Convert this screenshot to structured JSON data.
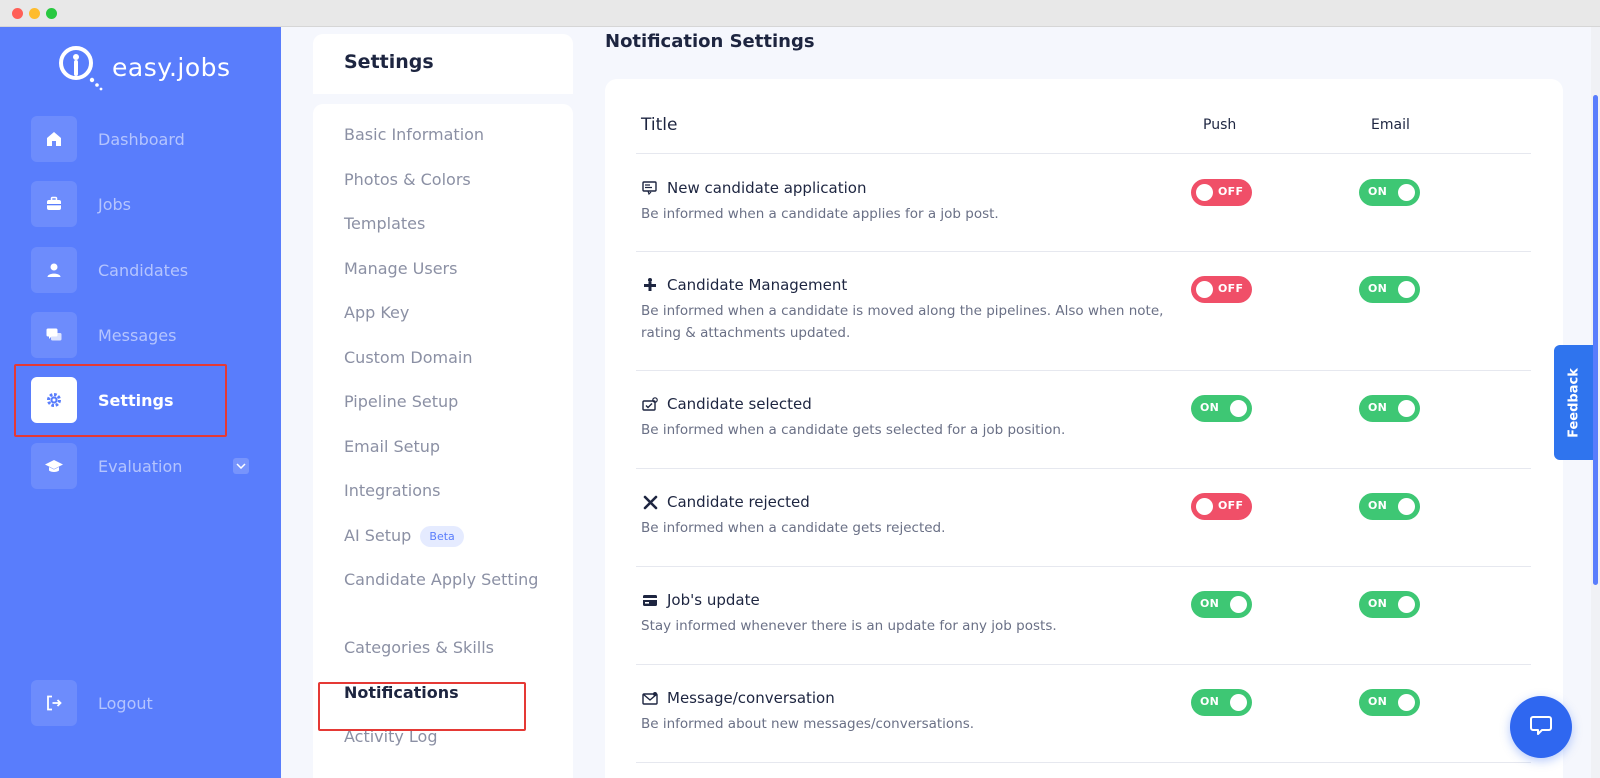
{
  "app": {
    "name": "easy.jobs"
  },
  "sidebar": {
    "items": [
      {
        "label": "Dashboard",
        "icon": "home-icon"
      },
      {
        "label": "Jobs",
        "icon": "briefcase-icon"
      },
      {
        "label": "Candidates",
        "icon": "user-icon"
      },
      {
        "label": "Messages",
        "icon": "chat-icon"
      },
      {
        "label": "Settings",
        "icon": "gear-icon",
        "active": true
      },
      {
        "label": "Evaluation",
        "icon": "graduation-cap-icon",
        "has_dropdown": true
      }
    ],
    "logout": {
      "label": "Logout",
      "icon": "logout-icon"
    }
  },
  "settings_menu": {
    "title": "Settings",
    "items": [
      {
        "label": "Basic Information"
      },
      {
        "label": "Photos & Colors"
      },
      {
        "label": "Templates"
      },
      {
        "label": "Manage Users"
      },
      {
        "label": "App Key"
      },
      {
        "label": "Custom Domain"
      },
      {
        "label": "Pipeline Setup"
      },
      {
        "label": "Email Setup"
      },
      {
        "label": "Integrations"
      },
      {
        "label": "AI Setup",
        "badge": "Beta"
      },
      {
        "label": "Candidate Apply Setting"
      },
      {
        "label": "Categories & Skills"
      },
      {
        "label": "Notifications",
        "active": true
      },
      {
        "label": "Activity Log"
      }
    ]
  },
  "main": {
    "title": "Notification Settings",
    "columns": {
      "title": "Title",
      "push": "Push",
      "email": "Email"
    },
    "rows": [
      {
        "icon": "application-icon",
        "title": "New candidate application",
        "desc": "Be informed when a candidate applies for a job post.",
        "push": "OFF",
        "email": "ON"
      },
      {
        "icon": "pipeline-icon",
        "title": "Candidate Management",
        "desc": "Be informed when a candidate is moved along the pipelines. Also when note, rating & attachments updated.",
        "push": "OFF",
        "email": "ON"
      },
      {
        "icon": "selected-icon",
        "title": "Candidate selected",
        "desc": "Be informed when a candidate gets selected for a job position.",
        "push": "ON",
        "email": "ON"
      },
      {
        "icon": "close-icon",
        "title": "Candidate rejected",
        "desc": "Be informed when a candidate gets rejected.",
        "push": "OFF",
        "email": "ON"
      },
      {
        "icon": "card-icon",
        "title": "Job's update",
        "desc": "Stay informed whenever there is an update for any job posts.",
        "push": "ON",
        "email": "ON"
      },
      {
        "icon": "mail-icon",
        "title": "Message/conversation",
        "desc": "Be informed about new messages/conversations.",
        "push": "ON",
        "email": "ON"
      }
    ]
  },
  "feedback": {
    "label": "Feedback"
  },
  "colors": {
    "brand": "#597dfc",
    "on": "#3ec774",
    "off": "#f04f68",
    "highlight": "#e53935"
  }
}
